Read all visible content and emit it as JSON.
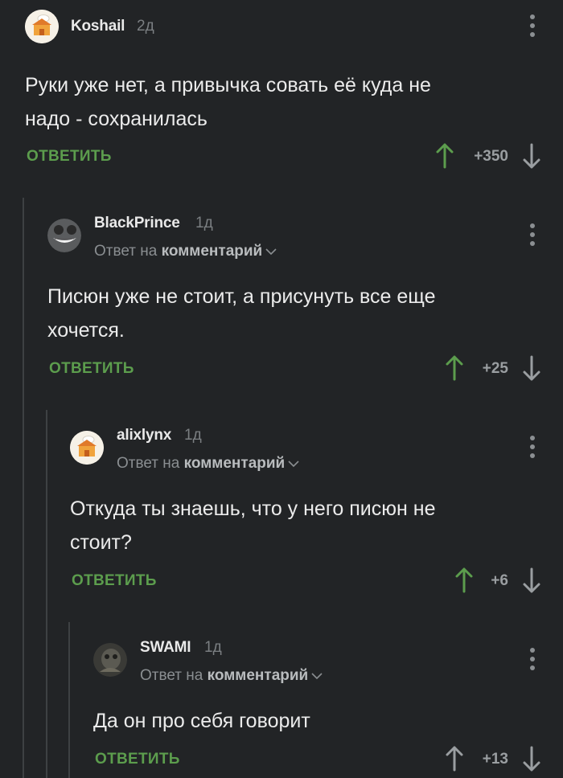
{
  "colors": {
    "background": "#222426",
    "accent_green": "#5c9d4d",
    "arrow_up": "#5c9d4d",
    "arrow_down": "#9a9ea1",
    "thread_line": "#3e4143"
  },
  "comments": [
    {
      "author": "Koshail",
      "time": "2д",
      "avatar": "chef-house-avatar",
      "text_lines": [
        "Руки уже нет, а привычка совать её куда не",
        "надо - сохранилась"
      ],
      "reply_label": "ОТВЕТИТЬ",
      "score": "+350"
    },
    {
      "author": "BlackPrince",
      "time": "1д",
      "avatar": "grin-face-avatar",
      "reply_to_prefix": "Ответ на",
      "reply_to_target": "комментарий",
      "text_lines": [
        "Писюн уже не стоит, а присунуть все еще",
        "хочется."
      ],
      "reply_label": "ОТВЕТИТЬ",
      "score": "+25"
    },
    {
      "author": "alixlynx",
      "time": "1д",
      "avatar": "chef-house-avatar",
      "reply_to_prefix": "Ответ на",
      "reply_to_target": "комментарий",
      "text_lines": [
        "Откуда ты знаешь, что у него писюн не",
        "стоит?"
      ],
      "reply_label": "ОТВЕТИТЬ",
      "score": "+6"
    },
    {
      "author": "SWAMI",
      "time": "1д",
      "avatar": "dark-photo-avatar",
      "reply_to_prefix": "Ответ на",
      "reply_to_target": "комментарий",
      "text_lines": [
        "Да он про себя говорит"
      ],
      "reply_label": "ОТВЕТИТЬ",
      "score": "+13"
    }
  ]
}
